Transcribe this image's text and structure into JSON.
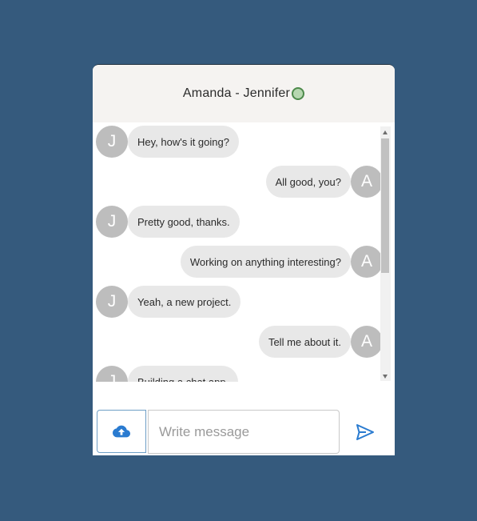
{
  "header": {
    "title": "Amanda - Jennifer",
    "status_color": "#b6d7b0"
  },
  "messages": [
    {
      "side": "left",
      "avatar": "J",
      "text": "Hey, how's it going?"
    },
    {
      "side": "right",
      "avatar": "A",
      "text": "All good, you?"
    },
    {
      "side": "left",
      "avatar": "J",
      "text": "Pretty good, thanks."
    },
    {
      "side": "right",
      "avatar": "A",
      "text": "Working on anything interesting?"
    },
    {
      "side": "left",
      "avatar": "J",
      "text": "Yeah, a new project."
    },
    {
      "side": "right",
      "avatar": "A",
      "text": "Tell me about it."
    },
    {
      "side": "left",
      "avatar": "J",
      "text": "Building a chat app."
    }
  ],
  "composer": {
    "placeholder": "Write message",
    "upload_icon": "cloud-upload-icon",
    "send_icon": "send-icon",
    "accent": "#2a7bd0"
  },
  "colors": {
    "background": "#355a7d",
    "bubble": "#e8e8e8",
    "avatar": "#bdbdbd"
  }
}
